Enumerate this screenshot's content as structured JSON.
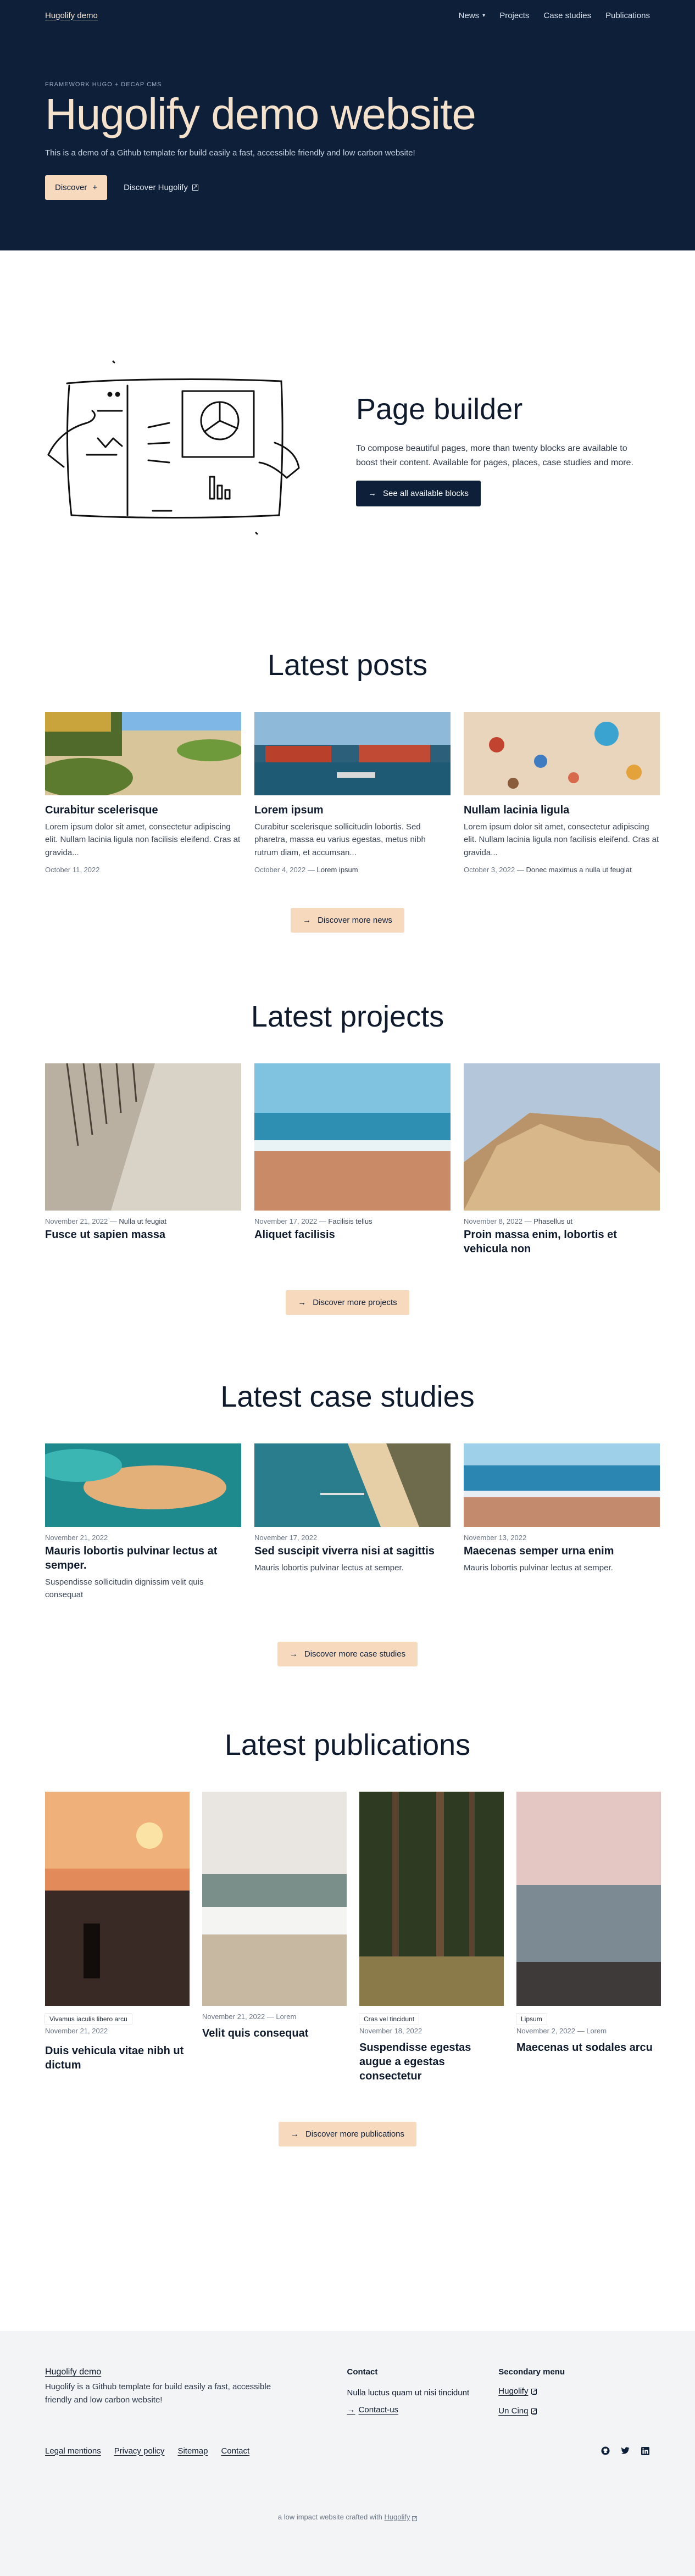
{
  "header": {
    "brand": "Hugolify demo",
    "nav": [
      {
        "label": "News",
        "has_dropdown": true
      },
      {
        "label": "Projects"
      },
      {
        "label": "Case studies"
      },
      {
        "label": "Publications"
      }
    ]
  },
  "hero": {
    "eyebrow": "FRAMEWORK HUGO + DECAP CMS",
    "title": "Hugolify demo website",
    "subtitle": "This is a demo of a Github template for build easily a fast, accessible friendly and low carbon website!",
    "primary_button": "Discover",
    "secondary_link": "Discover Hugolify"
  },
  "page_builder": {
    "title": "Page builder",
    "text": "To compose beautiful pages, more than twenty blocks are available to boost their content. Available for pages, places, case studies and more.",
    "button": "See all available blocks"
  },
  "posts": {
    "title": "Latest posts",
    "items": [
      {
        "title": "Curabitur scelerisque",
        "excerpt": "Lorem ipsum dolor sit amet, consectetur adipiscing elit. Nullam lacinia ligula non facilisis eleifend. Cras at gravida...",
        "date": "October 11, 2022",
        "category": ""
      },
      {
        "title": "Lorem ipsum",
        "excerpt": "Curabitur scelerisque sollicitudin lobortis. Sed pharetra, massa eu varius egestas, metus nibh rutrum diam, et accumsan...",
        "date": "October 4, 2022",
        "category": "Lorem ipsum"
      },
      {
        "title": "Nullam lacinia ligula",
        "excerpt": "Lorem ipsum dolor sit amet, consectetur adipiscing elit. Nullam lacinia ligula non facilisis eleifend. Cras at gravida...",
        "date": "October 3, 2022",
        "category": "Donec maximus a nulla ut feugiat"
      }
    ],
    "button": "Discover more news"
  },
  "projects": {
    "title": "Latest projects",
    "items": [
      {
        "date": "November 21, 2022",
        "category": "Nulla ut feugiat",
        "title": "Fusce ut sapien massa"
      },
      {
        "date": "November 17, 2022",
        "category": "Facilisis tellus",
        "title": "Aliquet facilisis"
      },
      {
        "date": "November 8, 2022",
        "category": "Phasellus ut",
        "title": "Proin massa enim, lobortis et vehicula non"
      }
    ],
    "button": "Discover more projects"
  },
  "case_studies": {
    "title": "Latest case studies",
    "items": [
      {
        "date": "November 21, 2022",
        "title": "Mauris lobortis pulvinar lectus at semper.",
        "excerpt": "Suspendisse sollicitudin dignissim velit quis consequat"
      },
      {
        "date": "November 17, 2022",
        "title": "Sed suscipit viverra nisi at sagittis",
        "excerpt": "Mauris lobortis pulvinar lectus at semper."
      },
      {
        "date": "November 13, 2022",
        "title": "Maecenas semper urna enim",
        "excerpt": "Mauris lobortis pulvinar lectus at semper."
      }
    ],
    "button": "Discover more case studies"
  },
  "publications": {
    "title": "Latest publications",
    "items": [
      {
        "tag": "Vivamus iaculis libero arcu",
        "date": "November 21, 2022",
        "category": "",
        "title": "Duis vehicula vitae nibh ut dictum"
      },
      {
        "tag": "",
        "date": "November 21, 2022",
        "category": "Lorem",
        "title": "Velit quis consequat"
      },
      {
        "tag": "Cras vel tincidunt",
        "date": "November 18, 2022",
        "category": "",
        "title": "Suspendisse egestas augue a egestas consectetur"
      },
      {
        "tag": "Lipsum",
        "date": "November 2, 2022",
        "category": "Lorem",
        "title": "Maecenas ut sodales arcu"
      }
    ],
    "button": "Discover more publications"
  },
  "footer": {
    "brand": "Hugolify demo",
    "text": "Hugolify is a Github template for build easily a fast, accessible friendly and low carbon website!",
    "contact_title": "Contact",
    "contact_text": "Nulla luctus quam ut nisi tincidunt",
    "contact_link": "Contact-us",
    "secondary_title": "Secondary menu",
    "secondary_links": [
      "Hugolify",
      "Un Cinq"
    ],
    "legal_links": [
      "Legal mentions",
      "Privacy policy",
      "Sitemap",
      "Contact"
    ],
    "credit_prefix": "a low impact website crafted with",
    "credit_link": "Hugolify"
  },
  "colors": {
    "navy": "#0e1f3a",
    "peach": "#f7d9bd",
    "footer_bg": "#f3f4f6"
  }
}
